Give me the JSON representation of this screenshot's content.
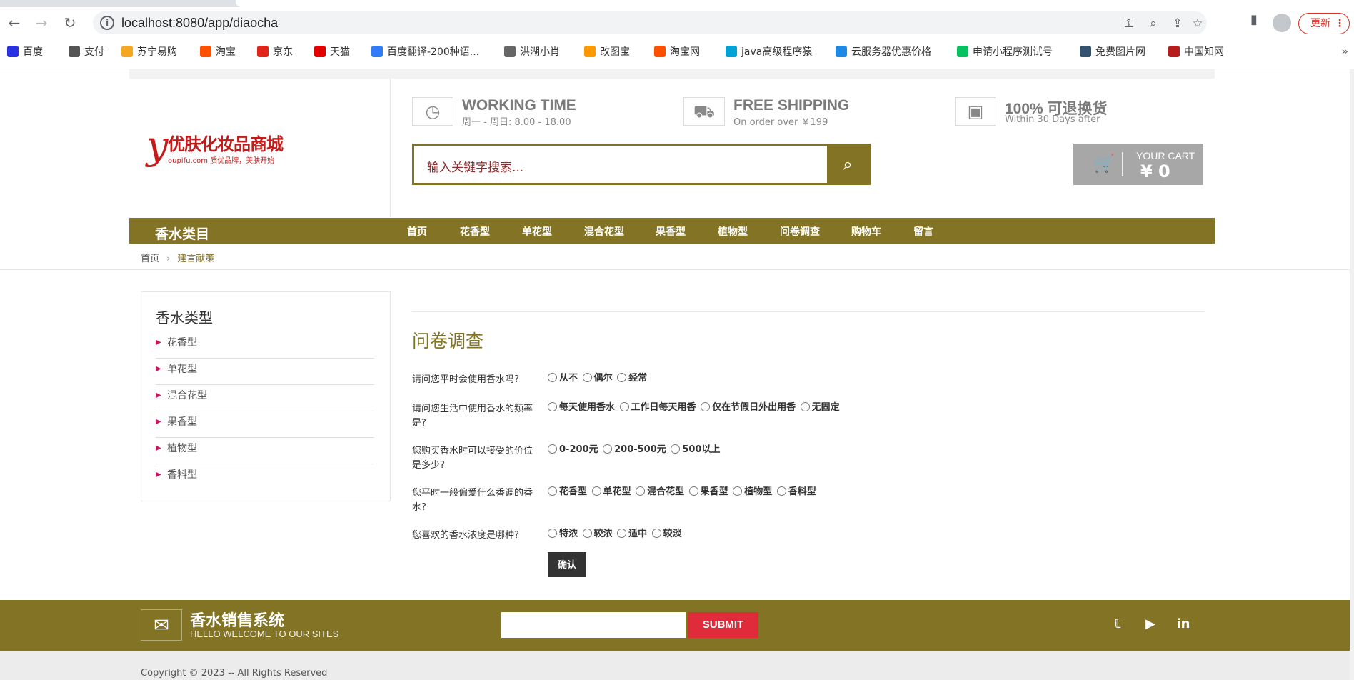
{
  "browser": {
    "url": "localhost:8080/app/diaocha",
    "update_label": "更新",
    "bookmarks": [
      {
        "label": "百度",
        "color": "#2932e1"
      },
      {
        "label": "支付",
        "color": "#555555"
      },
      {
        "label": "苏宁易购",
        "color": "#f5a623"
      },
      {
        "label": "淘宝",
        "color": "#ff5000"
      },
      {
        "label": "京东",
        "color": "#e1251b"
      },
      {
        "label": "天猫",
        "color": "#e00000"
      },
      {
        "label": "百度翻译-200种语...",
        "color": "#2f7cf6"
      },
      {
        "label": "洪湖小肖",
        "color": "#666666"
      },
      {
        "label": "改图宝",
        "color": "#ff9800"
      },
      {
        "label": "淘宝网",
        "color": "#ff5000"
      },
      {
        "label": "java高级程序猿",
        "color": "#00a1d6"
      },
      {
        "label": "云服务器优惠价格",
        "color": "#1e88e5"
      },
      {
        "label": "申请小程序测试号",
        "color": "#07c160"
      },
      {
        "label": "免费图片网",
        "color": "#34526f"
      },
      {
        "label": "中国知网",
        "color": "#b71c1c"
      }
    ]
  },
  "header": {
    "logo_letter": "y",
    "logo_text": "优肤化妆品商城",
    "logo_sub": "oupifu.com 质优品牌，美肤开始",
    "features": [
      {
        "title": "WORKING TIME",
        "sub": "周一 - 周日: 8.00 - 18.00",
        "icon": "clock-icon"
      },
      {
        "title": "FREE SHIPPING",
        "sub": "On order over ￥199",
        "icon": "truck-icon"
      },
      {
        "title": "100% 可退换货",
        "sub": "Within 30 Days after",
        "icon": "money-icon"
      }
    ],
    "search_placeholder": "输入关键字搜索...",
    "cart_label": "YOUR CART",
    "cart_amount": "¥ 0"
  },
  "menu": {
    "category": "香水类目",
    "items": [
      "首页",
      "花香型",
      "单花型",
      "混合花型",
      "果香型",
      "植物型",
      "问卷调查",
      "购物车",
      "留言"
    ]
  },
  "breadcrumb": {
    "home": "首页",
    "current": "建言献策"
  },
  "sidebar": {
    "title": "香水类型",
    "items": [
      "花香型",
      "单花型",
      "混合花型",
      "果香型",
      "植物型",
      "香料型"
    ]
  },
  "survey": {
    "title": "问卷调查",
    "questions": [
      {
        "label": "请问您平时会使用香水吗?",
        "options": [
          "从不",
          "偶尔",
          "经常"
        ]
      },
      {
        "label": "请问您生活中使用香水的频率是?",
        "options": [
          "每天使用香水",
          "工作日每天用香",
          "仅在节假日外出用香",
          "无固定"
        ]
      },
      {
        "label": "您购买香水时可以接受的价位是多少?",
        "options": [
          "0-200元",
          "200-500元",
          "500以上"
        ]
      },
      {
        "label": "您平时一般偏爱什么香调的香水?",
        "options": [
          "花香型",
          "单花型",
          "混合花型",
          "果香型",
          "植物型",
          "香料型"
        ]
      },
      {
        "label": "您喜欢的香水浓度是哪种?",
        "options": [
          "特浓",
          "较浓",
          "适中",
          "较淡"
        ]
      }
    ],
    "confirm_label": "确认"
  },
  "footer": {
    "title": "香水销售系统",
    "subtitle": "HELLO WELCOME TO OUR SITES",
    "submit_label": "SUBMIT",
    "copyright": "Copyright © 2023 -- All Rights Reserved"
  },
  "colors": {
    "brand": "#837324",
    "submit": "#e02b3a"
  }
}
